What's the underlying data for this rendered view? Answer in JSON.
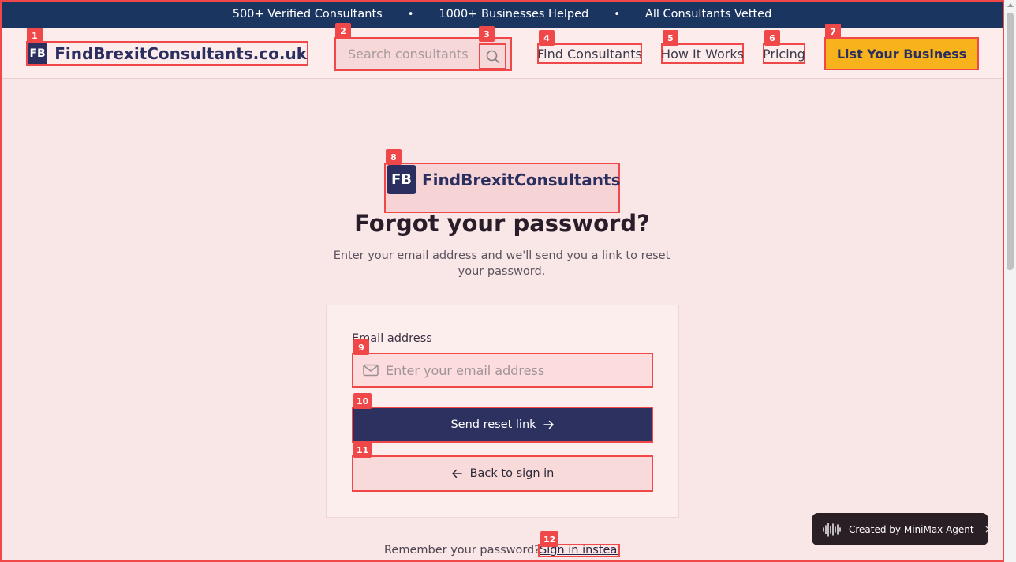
{
  "topbar": {
    "stats": [
      "500+ Verified Consultants",
      "1000+ Businesses Helped",
      "All Consultants Vetted"
    ],
    "separator": "•"
  },
  "header": {
    "logo_mark": "FB",
    "logo_text": "FindBrexitConsultants.co.uk",
    "search_placeholder": "Search consultants",
    "nav": {
      "find": "Find Consultants",
      "how": "How It Works",
      "pricing": "Pricing"
    },
    "cta": "List Your Business"
  },
  "badges": [
    "1",
    "2",
    "3",
    "4",
    "5",
    "6",
    "7",
    "8",
    "9",
    "10",
    "11",
    "12"
  ],
  "brand": {
    "mark": "FB",
    "name": "FindBrexitConsultants"
  },
  "form": {
    "title": "Forgot your password?",
    "subtitle": "Enter your email address and we'll send you a link to reset your password.",
    "email_label": "Email address",
    "email_placeholder": "Enter your email address",
    "send_label": "Send reset link",
    "back_label": "Back to sign in",
    "remember_text": "Remember your password?",
    "signin_link": "Sign in instead"
  },
  "toast": {
    "text": "Created by MiniMax Agent",
    "close": "×"
  },
  "colors": {
    "navy": "#1b3561",
    "brand": "#2b2f5f",
    "accent_yellow": "#f7b21c",
    "highlight_red": "#f04848",
    "background": "#f9e6e6"
  },
  "icons": {
    "search": "search-icon",
    "mail": "mail-icon",
    "arrow_right": "arrow-right-icon",
    "arrow_left": "arrow-left-icon",
    "waveform": "waveform-icon",
    "close": "close-icon"
  }
}
